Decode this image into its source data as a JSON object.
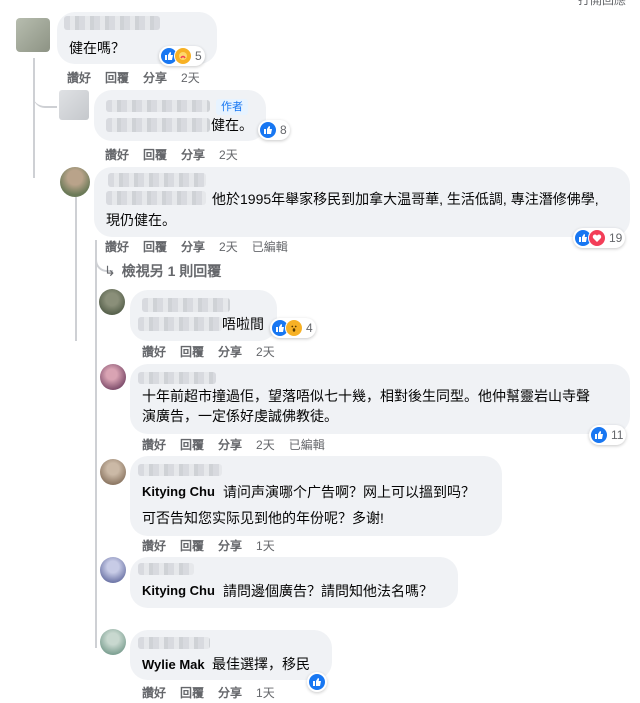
{
  "header": {
    "top_right_text": "打開回應"
  },
  "actions": {
    "like": "讚好",
    "reply": "回覆",
    "share": "分享",
    "edited": "已編輯"
  },
  "comments": [
    {
      "body": "健在嗎？",
      "reactions": "5",
      "time": "2天"
    },
    {
      "author_badge": "作者",
      "body": "健在。",
      "reactions": "8",
      "time": "2天"
    },
    {
      "body_line1": "他於1995年舉家移民到加拿大温哥華, 生活低調, 專注潛修佛學,",
      "body_line2": "現仍健在。",
      "reactions": "19",
      "time": "2天"
    },
    {
      "body": "唔啦間",
      "reactions": "4",
      "time": "2天"
    },
    {
      "body_line1": "十年前超市撞過佢，望落唔似七十幾，相對後生同型。他仲幫靈岩山寺聲",
      "body_line2": "演廣告，一定係好虔誠佛教徒。",
      "reactions": "11",
      "time": "2天"
    },
    {
      "mention": "Kitying Chu",
      "body_line1": "请问声演哪个广告啊？网上可以搵到吗？",
      "body_line2": "可否告知您实际见到他的年份呢？多谢!",
      "time": "1天"
    },
    {
      "mention": "Kitying Chu",
      "body": "請問邊個廣告？請問知他法名嗎？",
      "time": "1天"
    },
    {
      "mention": "Wylie Mak",
      "body": "最佳選擇，移民",
      "time": "1天"
    }
  ],
  "view_more_replies": "檢視另 1 則回覆",
  "colors": {
    "like_blue": "#1877f2",
    "heart_red": "#f33e58",
    "wow_yellow": "#f7b125",
    "bubble_grey": "#f0f2f5",
    "meta_grey": "#65676b"
  }
}
